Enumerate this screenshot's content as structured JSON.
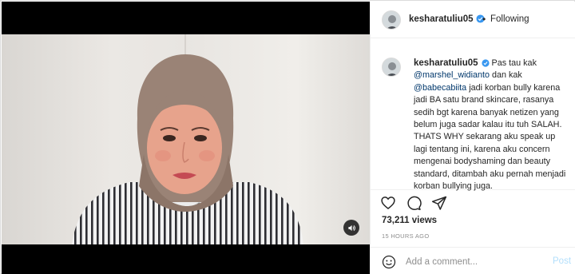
{
  "post": {
    "username": "kesharatuliu05",
    "separator": "•",
    "follow_label": "Following",
    "caption": {
      "username": "kesharatuliu05",
      "part1": "Pas tau kak",
      "mention1": "@marshel_widianto",
      "part2": "dan kak",
      "mention2": "@babecabiita",
      "part3": "jadi korban bully karena jadi BA satu brand skincare, rasanya sedih bgt karena banyak netizen yang belum juga sadar kalau itu tuh SALAH. THATS WHY sekarang aku speak up lagi tentang ini, karena aku concern mengenai bodyshaming dan beauty standard, ditambah aku pernah menjadi korban bullying juga."
    },
    "views": "73,211 views",
    "time_ago": "15 HOURS AGO",
    "comment": {
      "placeholder": "Add a comment...",
      "post_label": "Post"
    }
  },
  "icons": {
    "verified": "verified-badge-icon",
    "like": "heart-icon",
    "comment": "comment-bubble-icon",
    "share": "paper-plane-icon",
    "emoji": "smiley-icon",
    "audio": "speaker-icon"
  },
  "colors": {
    "verified": "#3897f0",
    "mention": "#00376b",
    "post_disabled": "#b2dffc",
    "secondary_text": "#8e8e8e"
  }
}
